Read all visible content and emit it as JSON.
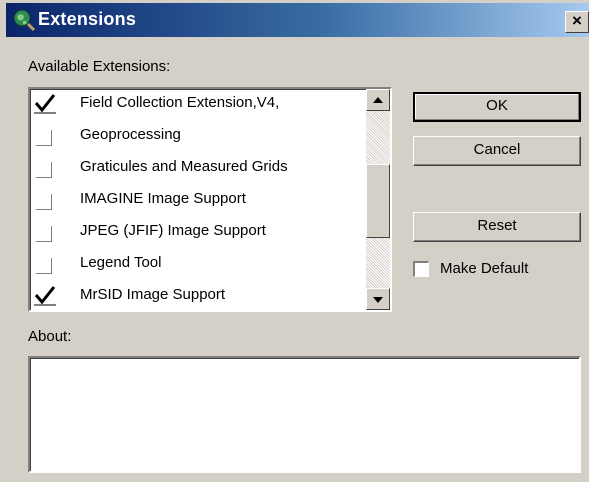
{
  "window": {
    "title": "Extensions",
    "close_label": "×"
  },
  "labels": {
    "available": "Available Extensions:",
    "about": "About:"
  },
  "extensions": [
    {
      "label": "Field Collection Extension,V4,",
      "checked": true
    },
    {
      "label": "Geoprocessing",
      "checked": false
    },
    {
      "label": "Graticules and Measured Grids",
      "checked": false
    },
    {
      "label": "IMAGINE Image Support",
      "checked": false
    },
    {
      "label": "JPEG (JFIF) Image Support",
      "checked": false
    },
    {
      "label": "Legend Tool",
      "checked": false
    },
    {
      "label": "MrSID Image Support",
      "checked": true
    }
  ],
  "buttons": {
    "ok": "OK",
    "cancel": "Cancel",
    "reset": "Reset"
  },
  "make_default": {
    "label": "Make Default",
    "checked": false
  },
  "about_text": "",
  "colors": {
    "title_bar_start": "#0a246a",
    "title_bar_end": "#a6caf0",
    "dialog_face": "#d4d0c8"
  }
}
